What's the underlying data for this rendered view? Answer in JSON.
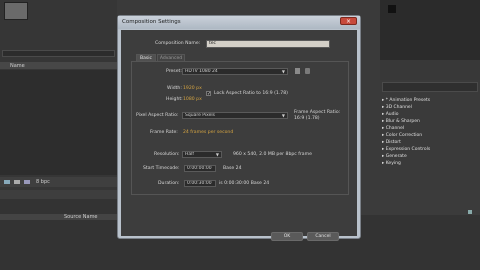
{
  "dialog": {
    "title": "Composition Settings",
    "comp_name_label": "Composition Name:",
    "comp_name_value": "tec",
    "tabs": [
      {
        "label": "Basic"
      },
      {
        "label": "Advanced"
      }
    ],
    "preset_label": "Preset:",
    "preset_value": "HDTV 1080 24",
    "width_label": "Width:",
    "width_value": "1920 px",
    "height_label": "Height:",
    "height_value": "1080 px",
    "lock_aspect": "Lock Aspect Ratio to 16:9 (1.78)",
    "pixel_aspect_label": "Pixel Aspect Ratio:",
    "pixel_aspect_value": "Square Pixels",
    "frame_aspect_label": "Frame Aspect Ratio:",
    "frame_aspect_value": "16:9 (1.78)",
    "frame_rate_label": "Frame Rate:",
    "frame_rate_value": "24 frames per second",
    "resolution_label": "Resolution:",
    "resolution_value": "Half",
    "resolution_info": "960 x 540, 2.0 MB per 8bpc frame",
    "start_timecode_label": "Start Timecode:",
    "start_timecode_value": "0:00:00:00",
    "start_timecode_base": "Base 24",
    "duration_label": "Duration:",
    "duration_value": "0:00:30:00",
    "duration_info": "is 0:00:30:00  Base 24",
    "ok_label": "OK",
    "cancel_label": "Cancel"
  },
  "effects_panel": {
    "items": [
      {
        "label": "* Animation Presets"
      },
      {
        "label": "3D Channel"
      },
      {
        "label": "Audio"
      },
      {
        "label": "Blur & Sharpen"
      },
      {
        "label": "Channel"
      },
      {
        "label": "Color Correction"
      },
      {
        "label": "Distort"
      },
      {
        "label": "Expression Controls"
      },
      {
        "label": "Generate"
      },
      {
        "label": "Keying"
      }
    ]
  },
  "project": {
    "col_name": "Name",
    "bpc": "8 bpc"
  },
  "timeline": {
    "source_name": "Source Name"
  },
  "colors": {
    "dialog_bg": "#b9c2cc",
    "body_bg": "#3d3d3d",
    "accent": "#d6a542",
    "close": "#c74a3c"
  }
}
